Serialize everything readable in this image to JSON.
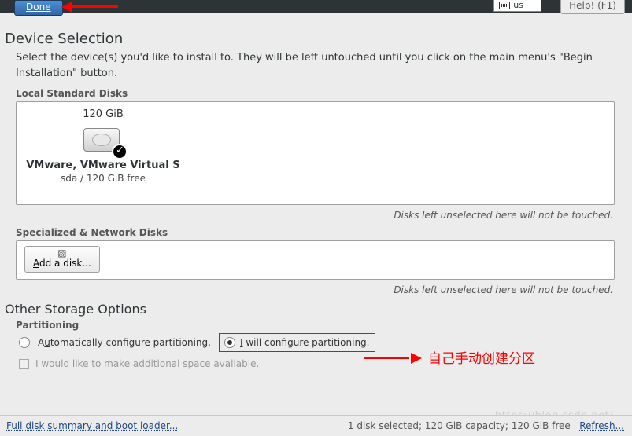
{
  "topbar": {
    "done": "Done",
    "lang": "us",
    "help": "Help! (F1)"
  },
  "header": {
    "title": "Device Selection",
    "intro": "Select the device(s) you'd like to install to.  They will be left untouched until you click on the main menu's \"Begin Installation\" button."
  },
  "local": {
    "label": "Local Standard Disks",
    "disk": {
      "size": "120 GiB",
      "name": "VMware, VMware Virtual S",
      "sub": "sda   /   120 GiB free"
    },
    "note": "Disks left unselected here will not be touched."
  },
  "network": {
    "label": "Specialized & Network Disks",
    "add": "Add a disk...",
    "note": "Disks left unselected here will not be touched."
  },
  "other": {
    "title": "Other Storage Options",
    "partitioning_label": "Partitioning",
    "auto": "Automatically configure partitioning.",
    "manual": "I will configure partitioning.",
    "additional": "I would like to make additional space available."
  },
  "annotation": {
    "cn": "自己手动创建分区"
  },
  "footer": {
    "link": "Full disk summary and boot loader...",
    "status": "1 disk selected; 120 GiB capacity; 120 GiB free",
    "refresh": "Refresh..."
  }
}
